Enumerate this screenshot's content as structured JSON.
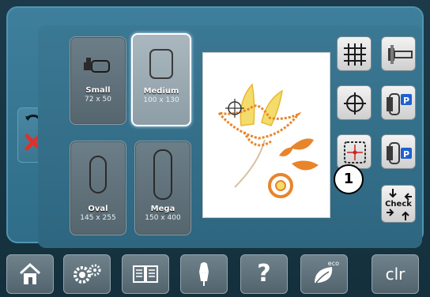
{
  "hoops": [
    {
      "name": "Small",
      "size": "72 x 50",
      "selected": false
    },
    {
      "name": "Medium",
      "size": "100 x 130",
      "selected": true
    },
    {
      "name": "Oval",
      "size": "145 x 255",
      "selected": false
    },
    {
      "name": "Mega",
      "size": "150 x 400",
      "selected": false
    }
  ],
  "callout": {
    "label": "1"
  },
  "side_buttons": {
    "grid": "grid-icon",
    "center": "crosshair-center-icon",
    "virtual_hoop": "virtual-position-icon",
    "park_top": "hoop-park-icon",
    "park_p1": "hoop-park-p-icon",
    "park_p2": "hoop-park-p-icon",
    "check": "Check"
  },
  "bottom_bar": {
    "home": "home-icon",
    "setup": "settings-icon",
    "tutorial": "book-icon",
    "consultant": "dress-form-icon",
    "help": "?",
    "eco": "eco",
    "clear": "clr"
  },
  "colors": {
    "accent_panel": "#3e7f9b",
    "design_orange": "#e8852a",
    "design_yellow": "#f2d040",
    "park_p_blue": "#1f5fd0",
    "cancel_red": "#e0302a"
  }
}
